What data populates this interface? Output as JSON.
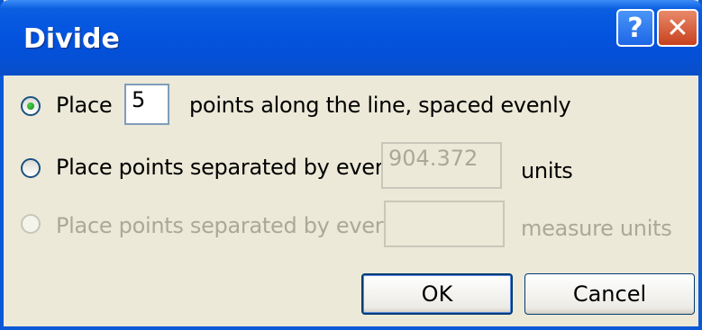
{
  "window": {
    "title": "Divide"
  },
  "titlebar": {
    "help_label": "?",
    "close_label": "✕"
  },
  "options": [
    {
      "prefix": "Place",
      "value": "5",
      "suffix": "points along the line, spaced evenly",
      "selected": true,
      "enabled": true
    },
    {
      "label": "Place points separated by every",
      "value": "904.372",
      "suffix": "units",
      "selected": false,
      "enabled": true
    },
    {
      "label": "Place points separated by every",
      "value": "",
      "suffix": "measure units",
      "selected": false,
      "enabled": false
    }
  ],
  "buttons": {
    "ok_label": "OK",
    "cancel_label": "Cancel"
  }
}
